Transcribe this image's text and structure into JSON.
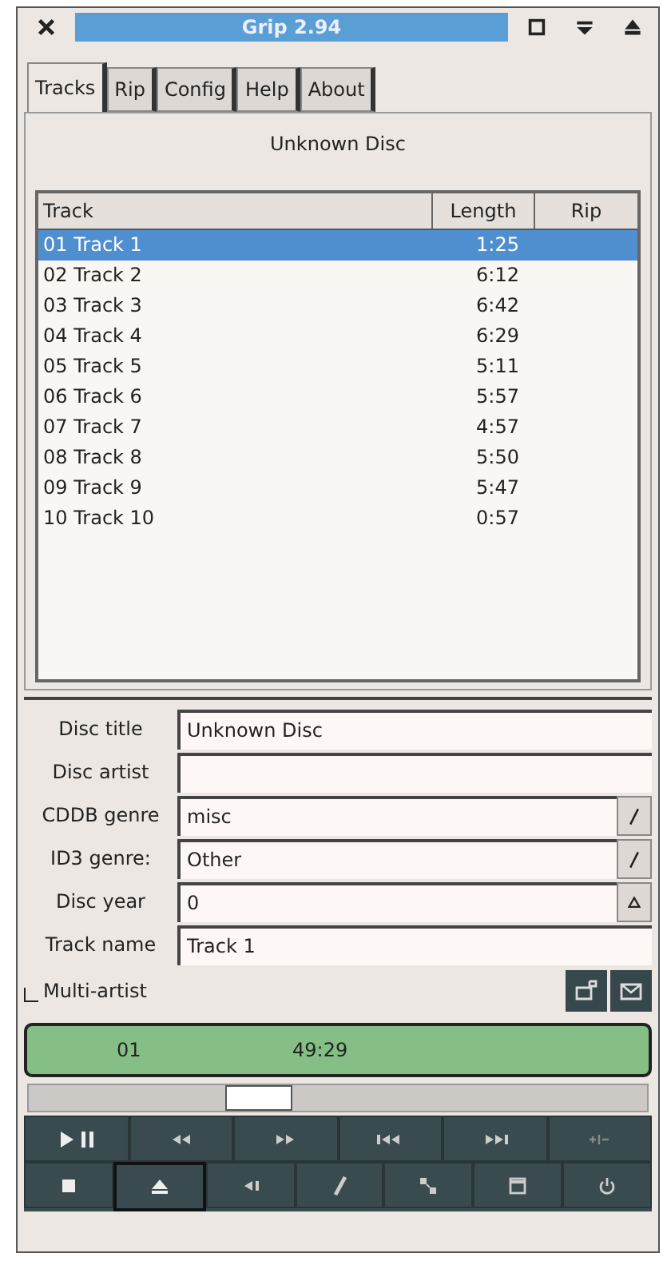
{
  "window": {
    "title": "Grip 2.94"
  },
  "tabs": [
    {
      "label": "Tracks",
      "selected": true
    },
    {
      "label": "Rip",
      "selected": false
    },
    {
      "label": "Config",
      "selected": false
    },
    {
      "label": "Help",
      "selected": false
    },
    {
      "label": "About",
      "selected": false
    }
  ],
  "disc_heading": "Unknown Disc",
  "table": {
    "columns": [
      "Track",
      "Length",
      "Rip"
    ],
    "rows": [
      {
        "track": "01  Track 1",
        "length": "1:25",
        "selected": true
      },
      {
        "track": "02  Track 2",
        "length": "6:12",
        "selected": false
      },
      {
        "track": "03  Track 3",
        "length": "6:42",
        "selected": false
      },
      {
        "track": "04  Track 4",
        "length": "6:29",
        "selected": false
      },
      {
        "track": "05  Track 5",
        "length": "5:11",
        "selected": false
      },
      {
        "track": "06  Track 6",
        "length": "5:57",
        "selected": false
      },
      {
        "track": "07  Track 7",
        "length": "4:57",
        "selected": false
      },
      {
        "track": "08  Track 8",
        "length": "5:50",
        "selected": false
      },
      {
        "track": "09  Track 9",
        "length": "5:47",
        "selected": false
      },
      {
        "track": "10  Track 10",
        "length": "0:57",
        "selected": false
      }
    ]
  },
  "fields": [
    {
      "label": "Disc title",
      "value": "Unknown Disc",
      "kind": "text"
    },
    {
      "label": "Disc artist",
      "kind": "text"
    },
    {
      "label": "CDDB genre",
      "value": "misc",
      "kind": "combo"
    },
    {
      "label": "ID3 genre:",
      "value": "Other",
      "kind": "combo"
    },
    {
      "label": "Disc year",
      "value": "0",
      "kind": "spin"
    },
    {
      "label": "Track name",
      "value": "Track 1",
      "kind": "text"
    }
  ],
  "multi_artist": {
    "label": "Multi-artist",
    "checked": false
  },
  "display": {
    "track": "01",
    "time": "49:29"
  },
  "position": {
    "level": 0.37
  }
}
